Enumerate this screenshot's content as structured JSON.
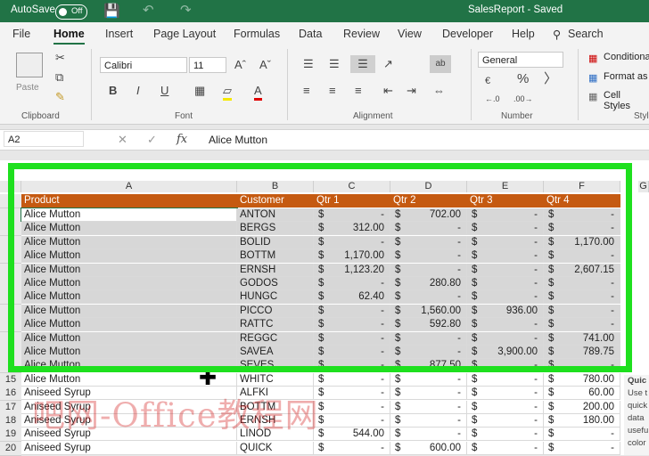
{
  "titlebar": {
    "autosave": "AutoSave",
    "toggle": "Off",
    "file_status": "SalesReport  -  Saved"
  },
  "tabs": [
    "File",
    "Home",
    "Insert",
    "Page Layout",
    "Formulas",
    "Data",
    "Review",
    "View",
    "Developer",
    "Help"
  ],
  "search": "Search",
  "ribbon": {
    "paste": "Paste",
    "font_name": "Calibri",
    "font_size": "11",
    "number_format": "General",
    "groups": {
      "clipboard": "Clipboard",
      "font": "Font",
      "alignment": "Alignment",
      "number": "Number",
      "styles": "Styl"
    },
    "styles_items": [
      "Conditiona",
      "Format as",
      "Cell Styles"
    ]
  },
  "formula_bar": {
    "name_box": "A2",
    "fx": "fx",
    "content": "Alice Mutton"
  },
  "columns": [
    "A",
    "B",
    "C",
    "D",
    "E",
    "F",
    "G"
  ],
  "sheet": {
    "headers": [
      "Product",
      "Customer",
      "Qtr 1",
      "Qtr 2",
      "Qtr 3",
      "Qtr 4"
    ],
    "rows": [
      {
        "n": "",
        "product": "Alice Mutton",
        "customer": "ANTON",
        "q1": "-",
        "q2": "702.00",
        "q3": "-",
        "q4": "-"
      },
      {
        "n": "",
        "product": "Alice Mutton",
        "customer": "BERGS",
        "q1": "312.00",
        "q2": "-",
        "q3": "-",
        "q4": "-"
      },
      {
        "n": "",
        "product": "Alice Mutton",
        "customer": "BOLID",
        "q1": "-",
        "q2": "-",
        "q3": "-",
        "q4": "1,170.00"
      },
      {
        "n": "",
        "product": "Alice Mutton",
        "customer": "BOTTM",
        "q1": "1,170.00",
        "q2": "-",
        "q3": "-",
        "q4": "-"
      },
      {
        "n": "",
        "product": "Alice Mutton",
        "customer": "ERNSH",
        "q1": "1,123.20",
        "q2": "-",
        "q3": "-",
        "q4": "2,607.15"
      },
      {
        "n": "",
        "product": "Alice Mutton",
        "customer": "GODOS",
        "q1": "-",
        "q2": "280.80",
        "q3": "-",
        "q4": "-"
      },
      {
        "n": "",
        "product": "Alice Mutton",
        "customer": "HUNGC",
        "q1": "62.40",
        "q2": "-",
        "q3": "-",
        "q4": "-"
      },
      {
        "n": "",
        "product": "Alice Mutton",
        "customer": "PICCO",
        "q1": "-",
        "q2": "1,560.00",
        "q3": "936.00",
        "q4": "-"
      },
      {
        "n": "",
        "product": "Alice Mutton",
        "customer": "RATTC",
        "q1": "-",
        "q2": "592.80",
        "q3": "-",
        "q4": "-"
      },
      {
        "n": "",
        "product": "Alice Mutton",
        "customer": "REGGC",
        "q1": "-",
        "q2": "-",
        "q3": "-",
        "q4": "741.00"
      },
      {
        "n": "",
        "product": "Alice Mutton",
        "customer": "SAVEA",
        "q1": "-",
        "q2": "-",
        "q3": "3,900.00",
        "q4": "789.75"
      },
      {
        "n": "",
        "product": "Alice Mutton",
        "customer": "SEVES",
        "q1": "-",
        "q2": "877.50",
        "q3": "-",
        "q4": "-"
      },
      {
        "n": "15",
        "product": "Alice Mutton",
        "customer": "WHITC",
        "q1": "-",
        "q2": "-",
        "q3": "-",
        "q4": "780.00"
      },
      {
        "n": "16",
        "product": "Aniseed Syrup",
        "customer": "ALFKI",
        "q1": "-",
        "q2": "-",
        "q3": "-",
        "q4": "60.00"
      },
      {
        "n": "17",
        "product": "Aniseed Syrup",
        "customer": "BOTTM",
        "q1": "-",
        "q2": "-",
        "q3": "-",
        "q4": "200.00"
      },
      {
        "n": "18",
        "product": "Aniseed Syrup",
        "customer": "ERNSH",
        "q1": "-",
        "q2": "-",
        "q3": "-",
        "q4": "180.00"
      },
      {
        "n": "19",
        "product": "Aniseed Syrup",
        "customer": "LINOD",
        "q1": "544.00",
        "q2": "-",
        "q3": "-",
        "q4": "-"
      },
      {
        "n": "20",
        "product": "Aniseed Syrup",
        "customer": "QUICK",
        "q1": "-",
        "q2": "600.00",
        "q3": "-",
        "q4": "-"
      }
    ]
  },
  "side_panel": [
    "Quic",
    "Use t",
    "quick",
    "data",
    "usefu",
    "color"
  ],
  "watermark": "吧网-Office教程网",
  "colors": {
    "excel_green": "#217346",
    "header_orange": "#c55a11",
    "highlight": "#1ee01e"
  }
}
